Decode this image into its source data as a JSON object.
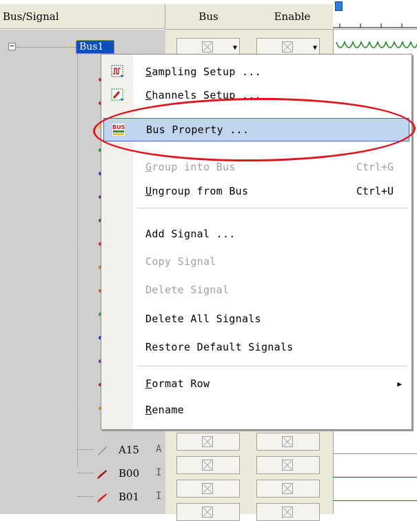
{
  "header": {
    "bus_signal": "Bus/Signal",
    "bus": "Bus",
    "enable": "Enable"
  },
  "tree": {
    "bus_name": "Bus1",
    "collapse_glyph": "−",
    "visible_signals": [
      {
        "name": "A15",
        "extra": "A",
        "probe_color": "#8c8c8c"
      },
      {
        "name": "B00",
        "extra": "I",
        "probe_color": "#a3101a"
      },
      {
        "name": "B01",
        "extra": "I",
        "probe_color": "#d61b1f"
      }
    ],
    "hidden_signal_colors": [
      "#c0281c",
      "#c0281c",
      "#e8c400",
      "#1e9b1e",
      "#1a3fb5",
      "#7a2a9a",
      "#555555",
      "#c0281c",
      "#c08020",
      "#e05a10",
      "#2f9b2f",
      "#1a3fb5",
      "#7a2a9a",
      "#c0281c",
      "#e0801a"
    ]
  },
  "menu": {
    "items": [
      {
        "label": "Sampling Setup ...",
        "underline": "S",
        "icon": "sampling-icon",
        "enabled": true,
        "selected": false
      },
      {
        "label": "Channels Setup ...",
        "underline": "C",
        "icon": "channels-icon",
        "enabled": true,
        "selected": false
      },
      {
        "label": "Bus Property ...",
        "underline": "",
        "icon": "bus-icon",
        "enabled": true,
        "selected": true
      },
      {
        "label": "Group into Bus",
        "underline": "G",
        "shortcut": "Ctrl+G",
        "enabled": false,
        "selected": false
      },
      {
        "label": "Ungroup from Bus",
        "underline": "U",
        "shortcut": "Ctrl+U",
        "enabled": true,
        "selected": false
      },
      {
        "label": "Add Signal ...",
        "enabled": true,
        "selected": false
      },
      {
        "label": "Copy Signal",
        "enabled": false,
        "selected": false
      },
      {
        "label": "Delete Signal",
        "enabled": false,
        "selected": false
      },
      {
        "label": "Delete All Signals",
        "enabled": true,
        "selected": false
      },
      {
        "label": "Restore Default Signals",
        "enabled": true,
        "selected": false
      },
      {
        "label": "Format Row",
        "underline": "F",
        "enabled": true,
        "selected": false,
        "has_submenu": true
      },
      {
        "label": "Rename",
        "underline": "R",
        "enabled": true,
        "selected": false
      }
    ],
    "submenu_arrow": "▶"
  },
  "colors": {
    "selection_bg": "#0a4fbd",
    "menu_highlight": "#c0d4ee",
    "annotation_ring": "#e0141b",
    "waveform": "#1e8b1e"
  }
}
